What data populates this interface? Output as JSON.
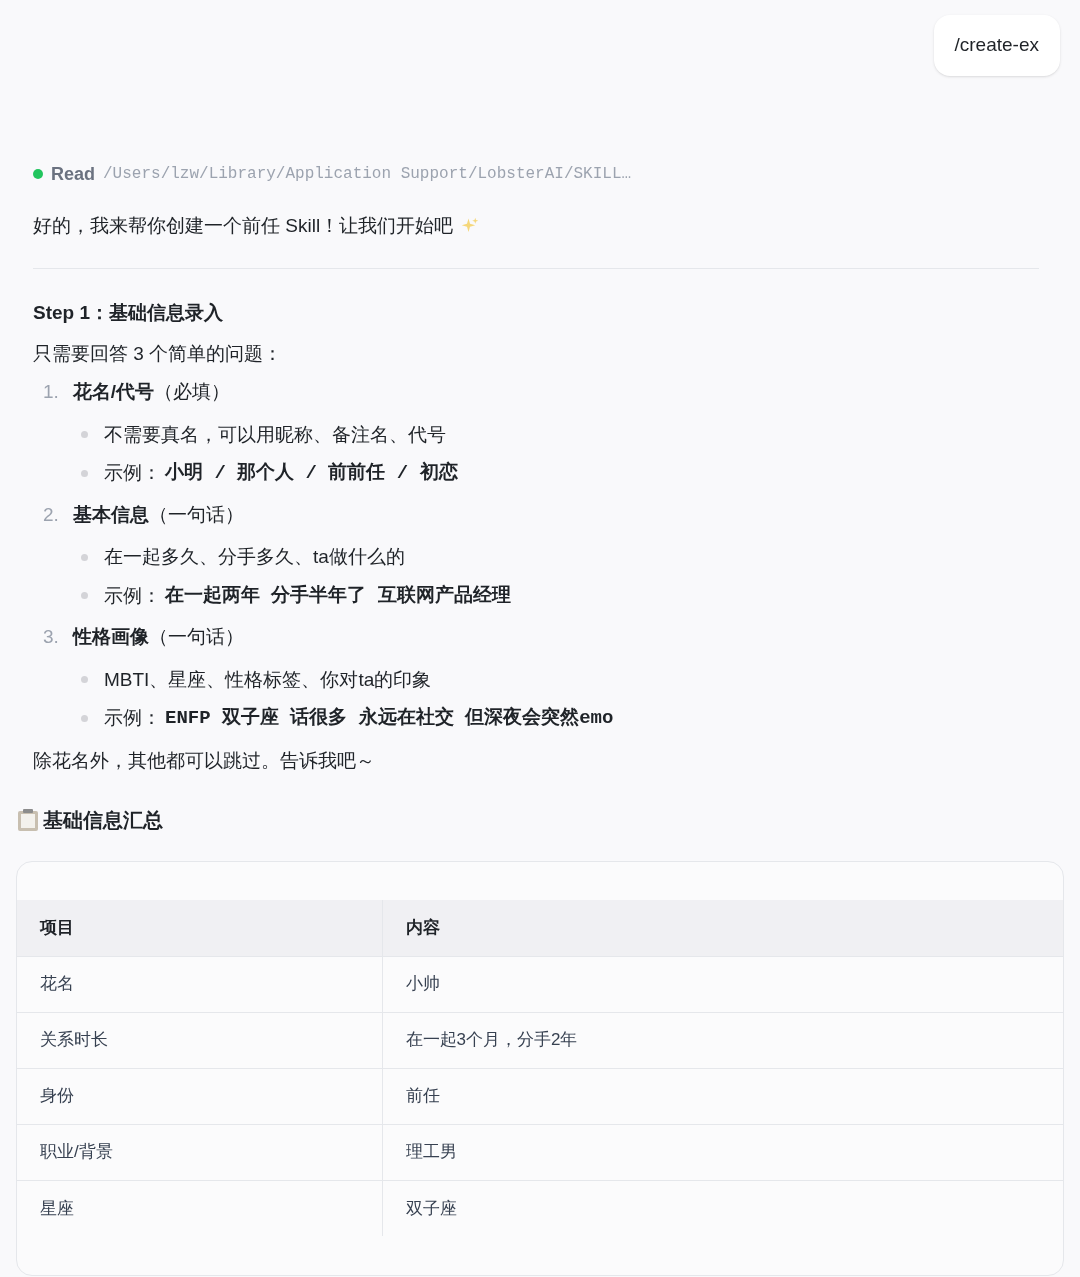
{
  "user_message": "/create-ex",
  "tool_call": {
    "completed": true,
    "action": "Read",
    "path": "/Users/lzw/Library/Application Support/LobsterAI/SKILL…"
  },
  "greeting": "好的，我来帮你创建一个前任 Skill！让我们开始吧",
  "step_title": "Step 1：基础信息录入",
  "intro": "只需要回答 3 个简单的问题：",
  "questions": [
    {
      "number": "1.",
      "title": "花名/代号",
      "note": "（必填）",
      "bullets": [
        {
          "kind": "plain",
          "text": "不需要真名，可以用昵称、备注名、代号"
        },
        {
          "kind": "example",
          "label": "示例：",
          "code": "小明 / 那个人 / 前前任 / 初恋"
        }
      ]
    },
    {
      "number": "2.",
      "title": "基本信息",
      "note": "（一句话）",
      "bullets": [
        {
          "kind": "plain",
          "text": "在一起多久、分手多久、ta做什么的"
        },
        {
          "kind": "example",
          "label": "示例：",
          "code": "在一起两年 分手半年了 互联网产品经理"
        }
      ]
    },
    {
      "number": "3.",
      "title": "性格画像",
      "note": "（一句话）",
      "bullets": [
        {
          "kind": "plain",
          "text": "MBTI、星座、性格标签、你对ta的印象"
        },
        {
          "kind": "example",
          "label": "示例：",
          "code": "ENFP 双子座 话很多 永远在社交 但深夜会突然emo"
        }
      ]
    }
  ],
  "closing": "除花名外，其他都可以跳过。告诉我吧～",
  "summary_title": "基础信息汇总",
  "table": {
    "columns": [
      "项目",
      "内容"
    ],
    "rows": [
      [
        "花名",
        "小帅"
      ],
      [
        "关系时长",
        "在一起3个月，分手2年"
      ],
      [
        "身份",
        "前任"
      ],
      [
        "职业/背景",
        "理工男"
      ],
      [
        "星座",
        "双子座"
      ]
    ]
  }
}
